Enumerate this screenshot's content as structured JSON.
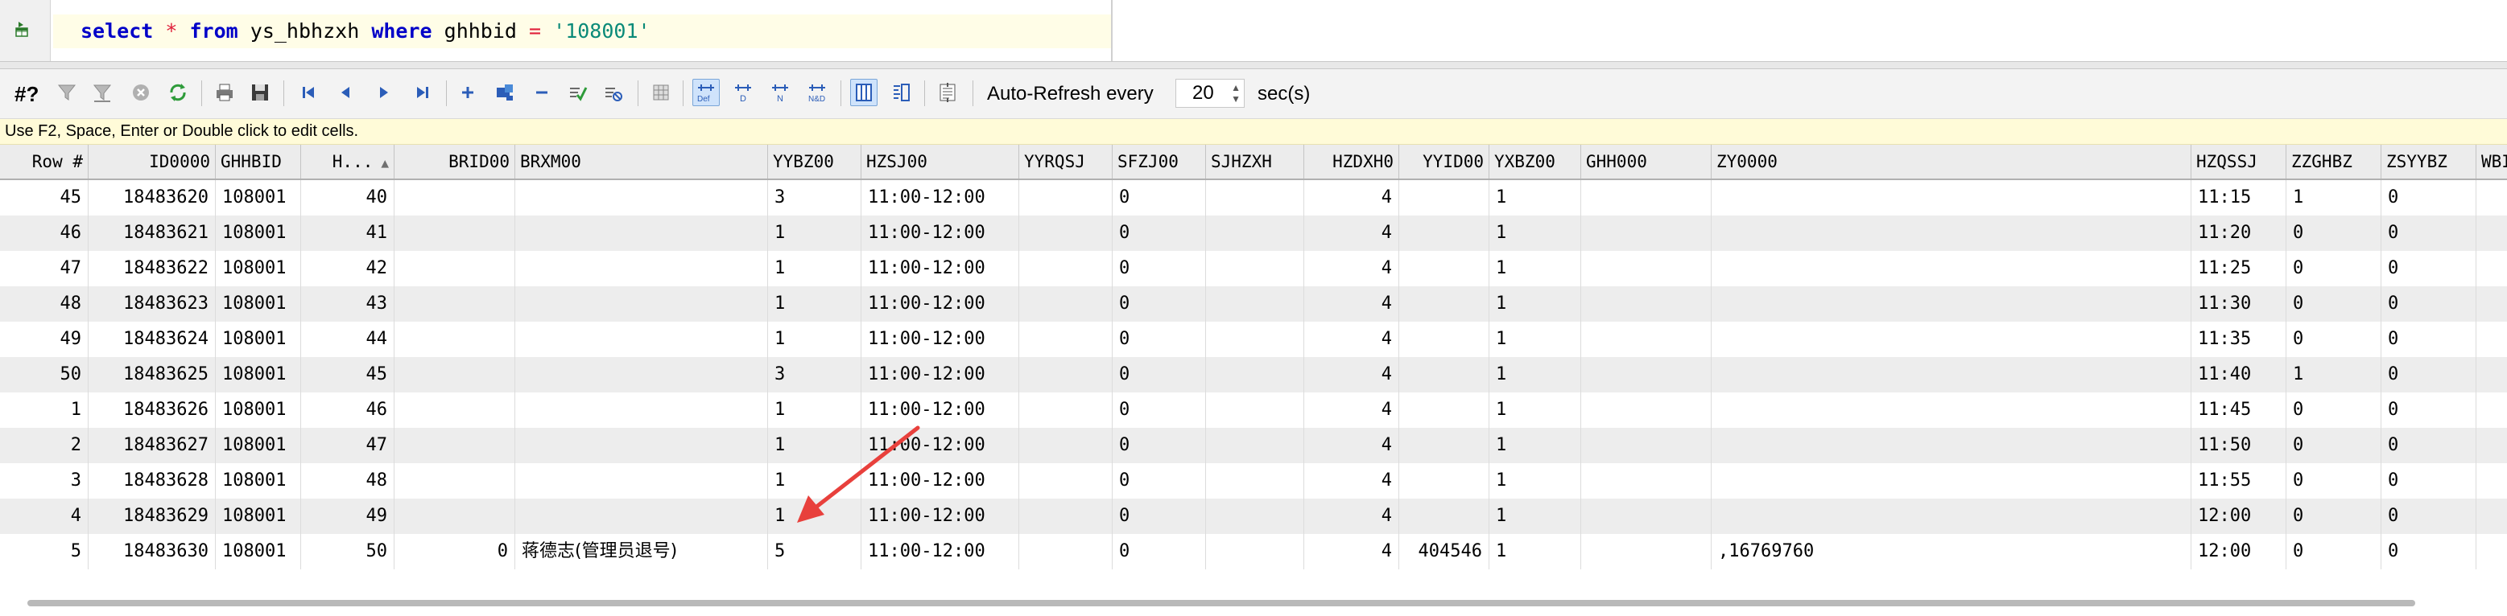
{
  "editor": {
    "sql": {
      "kw_select": "select",
      "star": "*",
      "kw_from": "from",
      "table": "ys_hbhzxh",
      "kw_where": "where",
      "column": "ghhbid",
      "eq": "=",
      "value": "'108001'"
    }
  },
  "toolbar": {
    "rowcount_label": "#?",
    "autorefresh_label": "Auto-Refresh every",
    "refresh_value": "20",
    "sec_label": "sec(s)",
    "icons": [
      "filter-icon",
      "filter-clear-icon",
      "cancel-icon",
      "refresh-icon",
      "print-icon",
      "save-icon",
      "first-record-icon",
      "prev-record-icon",
      "next-record-icon",
      "last-record-icon",
      "add-row-icon",
      "duplicate-row-icon",
      "delete-row-icon",
      "post-edit-icon",
      "cancel-edit-icon",
      "grid-mode-icon",
      "default-value-icon",
      "date-icon",
      "null-icon",
      "null-default-icon",
      "grid-view-icon",
      "form-view-icon",
      "text-view-icon"
    ]
  },
  "hint": "Use F2, Space, Enter or Double click to edit cells.",
  "grid": {
    "columns": [
      "Row #",
      "ID0000",
      "GHHBID",
      "H...",
      "BRID00",
      "BRXM00",
      "YYBZ00",
      "HZSJ00",
      "YYRQSJ",
      "SFZJ00",
      "SJHZXH",
      "HZDXH0",
      "YYID00",
      "YXBZ00",
      "GHH000",
      "ZY0000",
      "HZQSSJ",
      "ZZGHBZ",
      "ZSYYBZ",
      "WBI"
    ],
    "rows": [
      [
        "45",
        "18483620",
        "108001",
        "40",
        "",
        "",
        "3",
        "11:00-12:00",
        "",
        "0",
        "",
        "4",
        "",
        "1",
        "",
        "",
        "11:15",
        "1",
        "0"
      ],
      [
        "46",
        "18483621",
        "108001",
        "41",
        "",
        "",
        "1",
        "11:00-12:00",
        "",
        "0",
        "",
        "4",
        "",
        "1",
        "",
        "",
        "11:20",
        "0",
        "0"
      ],
      [
        "47",
        "18483622",
        "108001",
        "42",
        "",
        "",
        "1",
        "11:00-12:00",
        "",
        "0",
        "",
        "4",
        "",
        "1",
        "",
        "",
        "11:25",
        "0",
        "0"
      ],
      [
        "48",
        "18483623",
        "108001",
        "43",
        "",
        "",
        "1",
        "11:00-12:00",
        "",
        "0",
        "",
        "4",
        "",
        "1",
        "",
        "",
        "11:30",
        "0",
        "0"
      ],
      [
        "49",
        "18483624",
        "108001",
        "44",
        "",
        "",
        "1",
        "11:00-12:00",
        "",
        "0",
        "",
        "4",
        "",
        "1",
        "",
        "",
        "11:35",
        "0",
        "0"
      ],
      [
        "50",
        "18483625",
        "108001",
        "45",
        "",
        "",
        "3",
        "11:00-12:00",
        "",
        "0",
        "",
        "4",
        "",
        "1",
        "",
        "",
        "11:40",
        "1",
        "0"
      ],
      [
        "1",
        "18483626",
        "108001",
        "46",
        "",
        "",
        "1",
        "11:00-12:00",
        "",
        "0",
        "",
        "4",
        "",
        "1",
        "",
        "",
        "11:45",
        "0",
        "0"
      ],
      [
        "2",
        "18483627",
        "108001",
        "47",
        "",
        "",
        "1",
        "11:00-12:00",
        "",
        "0",
        "",
        "4",
        "",
        "1",
        "",
        "",
        "11:50",
        "0",
        "0"
      ],
      [
        "3",
        "18483628",
        "108001",
        "48",
        "",
        "",
        "1",
        "11:00-12:00",
        "",
        "0",
        "",
        "4",
        "",
        "1",
        "",
        "",
        "11:55",
        "0",
        "0"
      ],
      [
        "4",
        "18483629",
        "108001",
        "49",
        "",
        "",
        "1",
        "11:00-12:00",
        "",
        "0",
        "",
        "4",
        "",
        "1",
        "",
        "",
        "12:00",
        "0",
        "0"
      ],
      [
        "5",
        "18483630",
        "108001",
        "50",
        "0",
        "蒋德志(管理员退号)",
        "5",
        "11:00-12:00",
        "",
        "0",
        "",
        "4",
        "404546",
        "1",
        "",
        ",16769760",
        "12:00",
        "0",
        "0"
      ]
    ]
  },
  "colors": {
    "keyword": "#0000c8",
    "operator": "#e0203a",
    "string": "#0a8a78",
    "current_line": "#fffde7",
    "hint_bg": "#fffbd8",
    "annotation_arrow": "#e8403c"
  }
}
